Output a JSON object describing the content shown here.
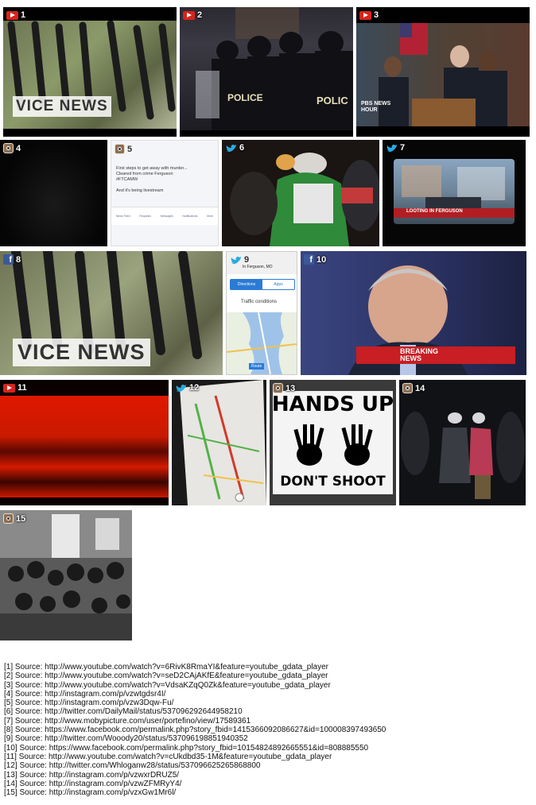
{
  "tiles": [
    {
      "num": "1",
      "platform": "youtube-icon",
      "overlay": "VICE NEWS"
    },
    {
      "num": "2",
      "platform": "youtube-icon",
      "overlay": "POLICE",
      "overlay2": "POLIC"
    },
    {
      "num": "3",
      "platform": "youtube-icon",
      "overlay": "PBS NEWS HOUR"
    },
    {
      "num": "4",
      "platform": "instagram-icon"
    },
    {
      "num": "5",
      "platform": "instagram-icon",
      "text1": "First steps to get away with murder...",
      "text2": "Cleared from crime Ferguson",
      "text3": "#FTCAMW",
      "text4": "And it's being livestream",
      "tabs": [
        "News Feed",
        "Requests",
        "Messages",
        "Notifications",
        "More"
      ]
    },
    {
      "num": "6",
      "platform": "twitter-icon"
    },
    {
      "num": "7",
      "platform": "twitter-icon",
      "overlay": "LOOTING IN FERGUSON"
    },
    {
      "num": "8",
      "platform": "facebook-icon",
      "overlay": "VICE NEWS"
    },
    {
      "num": "9",
      "platform": "twitter-icon",
      "location": "In Ferguson, MO",
      "tab1": "Directions",
      "tab2": "Apps",
      "title": "Traffic conditions",
      "button": "Route"
    },
    {
      "num": "10",
      "platform": "facebook-icon",
      "overlay": "BREAKING NEWS"
    },
    {
      "num": "11",
      "platform": "youtube-icon"
    },
    {
      "num": "12",
      "platform": "twitter-icon"
    },
    {
      "num": "13",
      "platform": "instagram-icon",
      "line1": "HANDS UP",
      "line2": "DON'T SHOOT"
    },
    {
      "num": "14",
      "platform": "instagram-icon"
    },
    {
      "num": "15",
      "platform": "instagram-icon"
    }
  ],
  "sources": [
    "[1] Source: http://www.youtube.com/watch?v=6RivK8RmaYI&feature=youtube_gdata_player",
    "[2] Source: http://www.youtube.com/watch?v=seD2CAjAKfE&feature=youtube_gdata_player",
    "[3] Source: http://www.youtube.com/watch?v=VdsaKZqQ0Zk&feature=youtube_gdata_player",
    "[4] Source: http://instagram.com/p/vzwtgdsr4I/",
    "[5] Source: http://instagram.com/p/vzw3Dqw-Fu/",
    "[6] Source: http://twitter.com/DailyMail/status/537096292644958210",
    "[7] Source: http://www.mobypicture.com/user/portefino/view/17589361",
    "[8] Source: https://www.facebook.com/permalink.php?story_fbid=1415366092086627&id=100008397493650",
    "[9] Source: http://twitter.com/Wooody20/status/537096198851940352",
    "[10] Source: https://www.facebook.com/permalink.php?story_fbid=10154824892665551&id=808885550",
    "[11] Source: http://www.youtube.com/watch?v=cUkdbd35-1M&feature=youtube_gdata_player",
    "[12] Source: http://twitter.com/Whloganw28/status/537096625265868800",
    "[13] Source: http://instagram.com/p/vzwxrDRUZ5/",
    "[14] Source: http://instagram.com/p/vzwZFMRyY4/",
    "[15] Source: http://instagram.com/p/vzxGw1Mr6l/"
  ]
}
